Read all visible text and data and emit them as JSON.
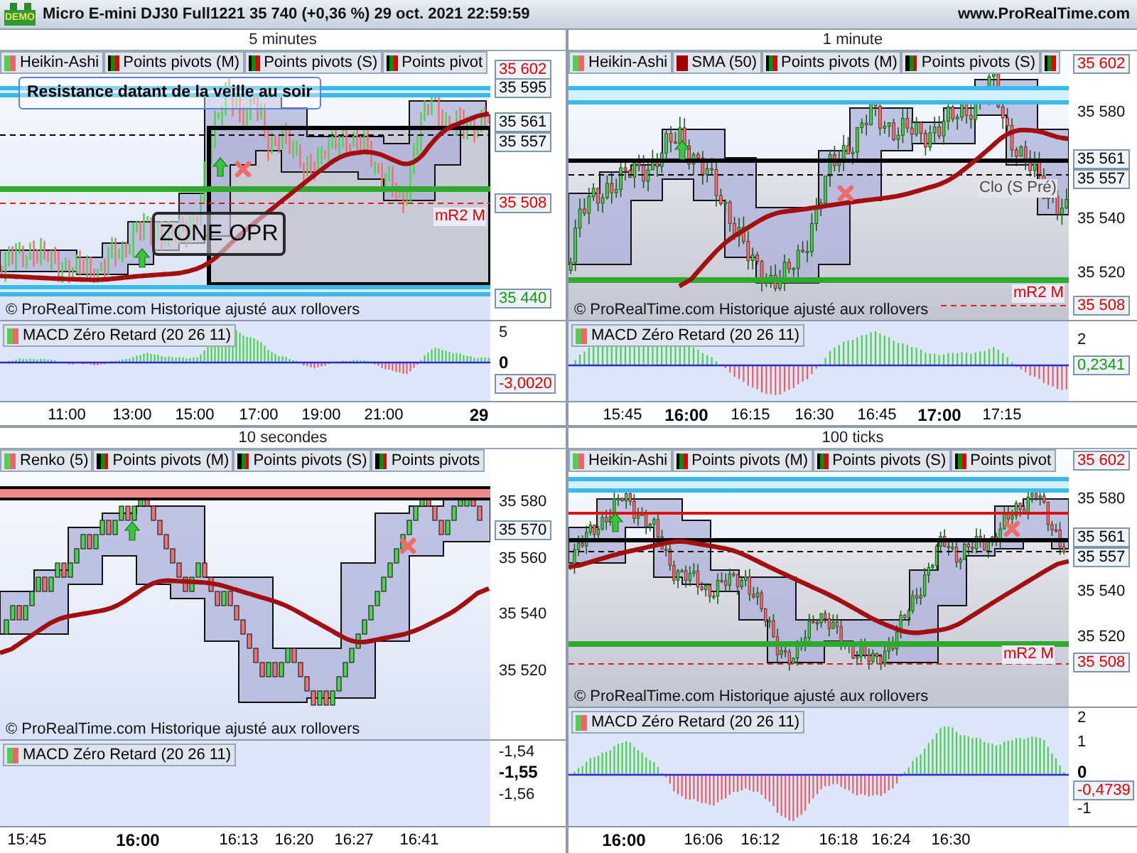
{
  "title_bar": {
    "logo": "DEMO",
    "title": "Micro E-mini DJ30 Full1221 35 740 (+0,36 %) 29 oct. 2021 22:59:59",
    "website": "www.ProRealTime.com"
  },
  "panels": [
    {
      "title": "5 minutes",
      "legend": [
        {
          "kind": "candles",
          "label": "Heikin-Ashi"
        },
        {
          "kind": "pivots",
          "label": "Points pivots (M)"
        },
        {
          "kind": "pivots",
          "label": "Points pivots (S)"
        },
        {
          "kind": "pivots",
          "label": "Points pivot"
        }
      ],
      "annotations": [
        {
          "kind": "note",
          "text": "Resistance datant de la veille au soir"
        },
        {
          "kind": "zone",
          "text": "ZONE OPR"
        },
        {
          "kind": "level",
          "text": "mR2 M"
        }
      ],
      "copyright": "© ProRealTime.com Historique ajusté aux rollovers",
      "price_labels": [
        {
          "kind": "tag_red",
          "text": "35 602"
        },
        {
          "kind": "tag",
          "text": "35 595"
        },
        {
          "kind": "tag",
          "text": "35 561"
        },
        {
          "kind": "tag",
          "text": "35 557"
        },
        {
          "kind": "tag_red",
          "text": "35 508"
        },
        {
          "kind": "tag_green",
          "text": "35 440"
        }
      ],
      "macd": {
        "legend": {
          "kind": "candles",
          "label": "MACD Zéro Retard (20 26 11)"
        },
        "labels": [
          {
            "kind": "tick",
            "text": "5"
          },
          {
            "kind": "tick_bold",
            "text": "0"
          },
          {
            "kind": "tag_red",
            "text": "-3,0020"
          }
        ]
      },
      "time_labels": [
        {
          "text": "11:00",
          "bold": false
        },
        {
          "text": "13:00",
          "bold": false
        },
        {
          "text": "15:00",
          "bold": false
        },
        {
          "text": "17:00",
          "bold": false
        },
        {
          "text": "19:00",
          "bold": false
        },
        {
          "text": "21:00",
          "bold": false
        },
        {
          "text": "29",
          "bold": true
        }
      ]
    },
    {
      "title": "1 minute",
      "legend": [
        {
          "kind": "candles",
          "label": "Heikin-Ashi"
        },
        {
          "kind": "sma",
          "label": "SMA (50)"
        },
        {
          "kind": "pivots",
          "label": "Points pivots (M)"
        },
        {
          "kind": "pivots",
          "label": "Points pivots (S)"
        },
        {
          "kind": "pivots"
        }
      ],
      "annotations": [
        {
          "kind": "close",
          "text": "Clo (S Pré)"
        },
        {
          "kind": "level",
          "text": "mR2 M"
        }
      ],
      "copyright": "© ProRealTime.com Historique ajusté aux rollovers",
      "price_labels": [
        {
          "kind": "tag_red",
          "text": "35 602"
        },
        {
          "kind": "tick",
          "text": "35 580"
        },
        {
          "kind": "tag",
          "text": "35 561"
        },
        {
          "kind": "tag",
          "text": "35 557"
        },
        {
          "kind": "tick",
          "text": "35 540"
        },
        {
          "kind": "tick",
          "text": "35 520"
        },
        {
          "kind": "tag_red",
          "text": "35 508"
        }
      ],
      "macd": {
        "legend": {
          "kind": "candles",
          "label": "MACD Zéro Retard (20 26 11)"
        },
        "labels": [
          {
            "kind": "tick",
            "text": "2"
          },
          {
            "kind": "tag_green",
            "text": "0,2341"
          }
        ]
      },
      "time_labels": [
        {
          "text": "15:45",
          "bold": false
        },
        {
          "text": "16:00",
          "bold": true
        },
        {
          "text": "16:15",
          "bold": false
        },
        {
          "text": "16:30",
          "bold": false
        },
        {
          "text": "16:45",
          "bold": false
        },
        {
          "text": "17:00",
          "bold": true
        },
        {
          "text": "17:15",
          "bold": false
        }
      ]
    },
    {
      "title": "10 secondes",
      "legend": [
        {
          "kind": "candles",
          "label": "Renko (5)"
        },
        {
          "kind": "pivots",
          "label": "Points pivots (M)"
        },
        {
          "kind": "pivots",
          "label": "Points pivots (S)"
        },
        {
          "kind": "pivots",
          "label": "Points pivots"
        }
      ],
      "copyright": "© ProRealTime.com Historique ajusté aux rollovers",
      "price_labels": [
        {
          "kind": "tick",
          "text": "35 580"
        },
        {
          "kind": "tag",
          "text": "35 570"
        },
        {
          "kind": "tick",
          "text": "35 560"
        },
        {
          "kind": "tick",
          "text": "35 540"
        },
        {
          "kind": "tick",
          "text": "35 520"
        }
      ],
      "macd": {
        "legend": {
          "kind": "candles",
          "label": "MACD Zéro Retard (20 26 11)"
        },
        "labels": [
          {
            "kind": "tick",
            "text": "-1,54"
          },
          {
            "kind": "tick_bold",
            "text": "-1,55"
          },
          {
            "kind": "tick",
            "text": "-1,56"
          }
        ]
      },
      "time_labels": [
        {
          "text": "15:45",
          "bold": false
        },
        {
          "text": "16:00",
          "bold": true
        },
        {
          "text": "16:13",
          "bold": false
        },
        {
          "text": "16:20",
          "bold": false
        },
        {
          "text": "16:27",
          "bold": false
        },
        {
          "text": "16:41",
          "bold": false
        }
      ]
    },
    {
      "title": "100 ticks",
      "legend": [
        {
          "kind": "candles",
          "label": "Heikin-Ashi"
        },
        {
          "kind": "pivots",
          "label": "Points pivots (M)"
        },
        {
          "kind": "pivots",
          "label": "Points pivots (S)"
        },
        {
          "kind": "pivots",
          "label": "Points pivot"
        }
      ],
      "annotations": [
        {
          "kind": "level",
          "text": "mR2 M"
        }
      ],
      "copyright": "© ProRealTime.com Historique ajusté aux rollovers",
      "price_labels": [
        {
          "kind": "tag_red",
          "text": "35 602"
        },
        {
          "kind": "tick",
          "text": "35 580"
        },
        {
          "kind": "tag",
          "text": "35 561"
        },
        {
          "kind": "tag",
          "text": "35 557"
        },
        {
          "kind": "tick",
          "text": "35 540"
        },
        {
          "kind": "tick",
          "text": "35 520"
        },
        {
          "kind": "tag_red",
          "text": "35 508"
        }
      ],
      "macd": {
        "legend": {
          "kind": "candles",
          "label": "MACD Zéro Retard (20 26 11)"
        },
        "labels": [
          {
            "kind": "tick",
            "text": "2"
          },
          {
            "kind": "tick",
            "text": "1"
          },
          {
            "kind": "tick_bold",
            "text": "0"
          },
          {
            "kind": "tag_red",
            "text": "-0,4739"
          },
          {
            "kind": "tick",
            "text": "-1"
          }
        ]
      },
      "time_labels": [
        {
          "text": "16:00",
          "bold": true
        },
        {
          "text": "16:06",
          "bold": false
        },
        {
          "text": "16:12",
          "bold": false
        },
        {
          "text": "16:18",
          "bold": false
        },
        {
          "text": "16:24",
          "bold": false
        },
        {
          "text": "16:30",
          "bold": false
        }
      ]
    }
  ]
}
